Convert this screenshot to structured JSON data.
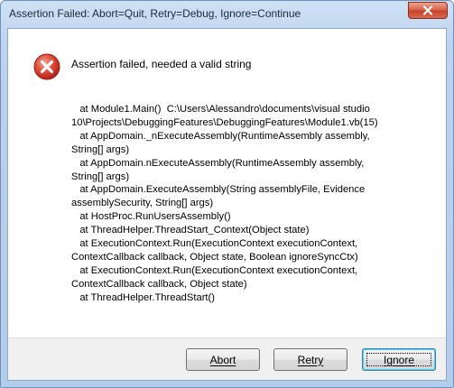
{
  "window": {
    "title": "Assertion Failed: Abort=Quit, Retry=Debug, Ignore=Continue"
  },
  "message": {
    "heading": "Assertion failed, needed a valid string",
    "stack_lines": [
      "   at Module1.Main()  C:\\Users\\Alessandro\\documents\\visual studio",
      "10\\Projects\\DebuggingFeatures\\DebuggingFeatures\\Module1.vb(15)",
      "   at AppDomain._nExecuteAssembly(RuntimeAssembly assembly,",
      "String[] args)",
      "   at AppDomain.nExecuteAssembly(RuntimeAssembly assembly,",
      "String[] args)",
      "   at AppDomain.ExecuteAssembly(String assemblyFile, Evidence",
      "assemblySecurity, String[] args)",
      "   at HostProc.RunUsersAssembly()",
      "   at ThreadHelper.ThreadStart_Context(Object state)",
      "   at ExecutionContext.Run(ExecutionContext executionContext,",
      "ContextCallback callback, Object state, Boolean ignoreSyncCtx)",
      "   at ExecutionContext.Run(ExecutionContext executionContext,",
      "ContextCallback callback, Object state)",
      "   at ThreadHelper.ThreadStart()"
    ]
  },
  "icons": {
    "error": "error-icon",
    "close": "close-icon"
  },
  "buttons": {
    "abort": "Abort",
    "retry": "Retry",
    "ignore": "Ignore"
  },
  "colors": {
    "error_red": "#d9352a",
    "close_red": "#c7432b",
    "frame_blue": "#b9d1ea"
  }
}
